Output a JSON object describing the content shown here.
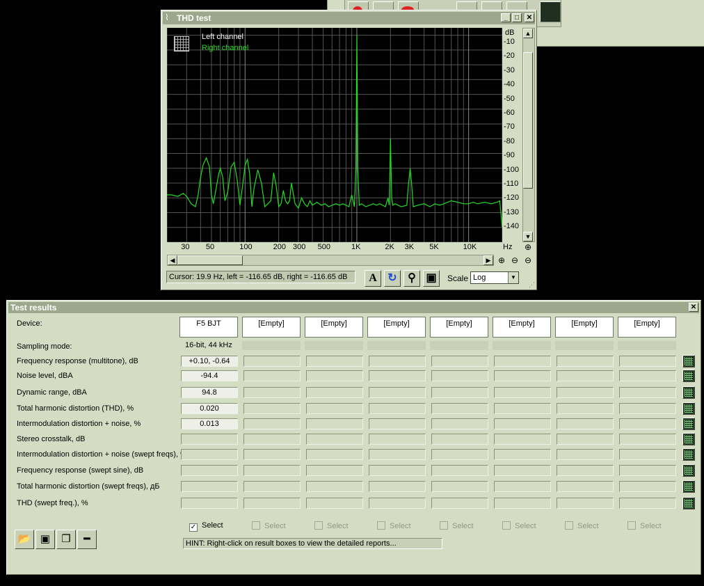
{
  "thd_window": {
    "title": "THD test",
    "legend": [
      {
        "label": "Left channel",
        "color": "#ffffff"
      },
      {
        "label": "Right channel",
        "color": "#22dd22"
      }
    ],
    "y_unit": "dB",
    "y_ticks": [
      "-10",
      "-20",
      "-30",
      "-40",
      "-50",
      "-60",
      "-70",
      "-80",
      "-90",
      "-100",
      "-110",
      "-120",
      "-130",
      "-140"
    ],
    "x_unit": "Hz",
    "x_ticks": [
      "30",
      "50",
      "100",
      "200",
      "300",
      "500",
      "1K",
      "2K",
      "3K",
      "5K",
      "10K"
    ],
    "cursor_text": "Cursor:  19.9 Hz,  left = -116.65 dB,  right = -116.65 dB",
    "scale_label": "Scale",
    "scale_value": "Log"
  },
  "chart_data": {
    "type": "line",
    "xscale": "log",
    "xlim": [
      20,
      20000
    ],
    "ylim": [
      -150,
      -5
    ],
    "series": [
      {
        "name": "Right channel",
        "color": "#22dd22",
        "x": [
          20,
          22,
          25,
          28,
          30,
          33,
          36,
          38,
          40,
          42,
          45,
          48,
          50,
          52,
          55,
          58,
          60,
          63,
          66,
          70,
          75,
          80,
          85,
          90,
          95,
          100,
          105,
          110,
          115,
          120,
          130,
          140,
          150,
          160,
          170,
          180,
          190,
          200,
          210,
          220,
          230,
          240,
          250,
          260,
          280,
          300,
          320,
          340,
          360,
          380,
          400,
          440,
          480,
          520,
          560,
          600,
          650,
          700,
          750,
          800,
          850,
          900,
          950,
          980,
          1000,
          1020,
          1050,
          1100,
          1200,
          1300,
          1400,
          1500,
          1600,
          1700,
          1800,
          1900,
          1950,
          2000,
          2050,
          2100,
          2200,
          2500,
          2800,
          2900,
          3000,
          3100,
          3200,
          3500,
          4000,
          4500,
          5000,
          5500,
          6000,
          7000,
          8000,
          9000,
          10000,
          11000,
          12000,
          14000,
          16000,
          18000,
          19000,
          20000
        ],
        "y": [
          -118,
          -118,
          -119,
          -117,
          -119,
          -124,
          -126,
          -118,
          -106,
          -98,
          -93,
          -99,
          -118,
          -124,
          -114,
          -104,
          -100,
          -106,
          -122,
          -116,
          -99,
          -96,
          -108,
          -125,
          -112,
          -98,
          -94,
          -104,
          -126,
          -114,
          -101,
          -110,
          -126,
          -124,
          -122,
          -103,
          -112,
          -126,
          -124,
          -115,
          -122,
          -124,
          -122,
          -110,
          -124,
          -127,
          -120,
          -124,
          -126,
          -122,
          -125,
          -123,
          -125,
          -124,
          -126,
          -125,
          -124,
          -125,
          -124,
          -125,
          -126,
          -118,
          -126,
          -100,
          -10,
          -100,
          -125,
          -124,
          -126,
          -125,
          -124,
          -125,
          -124,
          -125,
          -126,
          -120,
          -125,
          -80,
          -120,
          -125,
          -124,
          -126,
          -125,
          -110,
          -100,
          -112,
          -126,
          -125,
          -124,
          -126,
          -124,
          -125,
          -124,
          -122,
          -123,
          -124,
          -124,
          -123,
          -124,
          -123,
          -124,
          -123,
          -122,
          -140
        ]
      },
      {
        "name": "Left channel",
        "color": "#ffffff",
        "x": [],
        "y": []
      }
    ]
  },
  "results_window": {
    "title": "Test results",
    "device_label": "Device:",
    "devices": [
      "F5 BJT",
      "[Empty]",
      "[Empty]",
      "[Empty]",
      "[Empty]",
      "[Empty]",
      "[Empty]",
      "[Empty]"
    ],
    "sampling_label": "Sampling mode:",
    "sampling_values": [
      "16-bit, 44 kHz",
      "",
      "",
      "",
      "",
      "",
      "",
      ""
    ],
    "rows": [
      {
        "label": "Frequency response (multitone), dB",
        "values": [
          "+0.10, -0.64",
          "",
          "",
          "",
          "",
          "",
          "",
          ""
        ]
      },
      {
        "label": "Noise level, dBA",
        "values": [
          "-94.4",
          "",
          "",
          "",
          "",
          "",
          "",
          ""
        ]
      },
      {
        "label": "Dynamic range, dBA",
        "values": [
          "94.8",
          "",
          "",
          "",
          "",
          "",
          "",
          ""
        ]
      },
      {
        "label": "Total harmonic distortion (THD), %",
        "values": [
          "0.020",
          "",
          "",
          "",
          "",
          "",
          "",
          ""
        ]
      },
      {
        "label": "Intermodulation distortion + noise, %",
        "values": [
          "0.013",
          "",
          "",
          "",
          "",
          "",
          "",
          ""
        ]
      },
      {
        "label": "Stereo crosstalk, dB",
        "values": [
          "",
          "",
          "",
          "",
          "",
          "",
          "",
          ""
        ]
      },
      {
        "label": "Intermodulation distortion + noise (swept freqs), %",
        "values": [
          "",
          "",
          "",
          "",
          "",
          "",
          "",
          ""
        ]
      },
      {
        "label": "Frequency response (swept sine), dB",
        "values": [
          "",
          "",
          "",
          "",
          "",
          "",
          "",
          ""
        ]
      },
      {
        "label": "Total harmonic distortion (swept freqs), дБ",
        "values": [
          "",
          "",
          "",
          "",
          "",
          "",
          "",
          ""
        ]
      },
      {
        "label": "THD (swept freq.), %",
        "values": [
          "",
          "",
          "",
          "",
          "",
          "",
          "",
          ""
        ]
      }
    ],
    "select_label": "Select",
    "select_checked": [
      true,
      false,
      false,
      false,
      false,
      false,
      false,
      false
    ],
    "hint": "HINT: Right-click on result boxes to view the detailed reports..."
  }
}
